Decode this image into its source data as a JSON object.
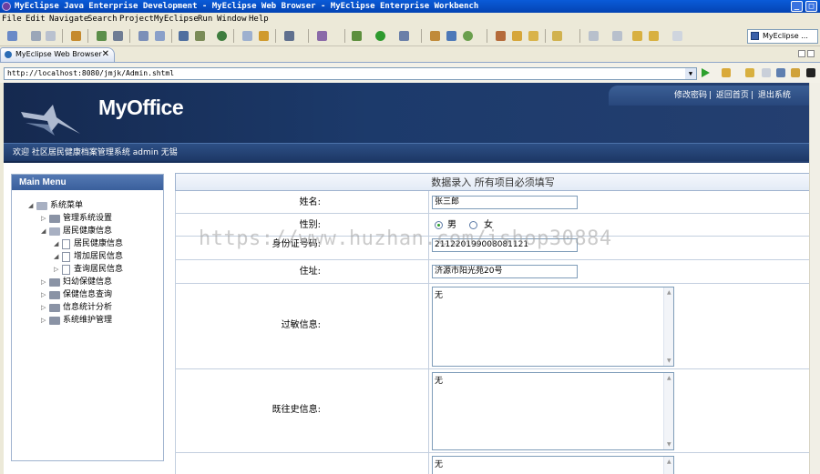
{
  "window": {
    "title": "MyEclipse Java Enterprise Development - MyEclipse Web Browser - MyEclipse Enterprise Workbench"
  },
  "menubar": [
    "File",
    "Edit",
    "Navigate",
    "Search",
    "Project",
    "MyEclipse",
    "Run",
    "Window",
    "Help"
  ],
  "toolbar": {
    "perspective_label": "MyEclipse ..."
  },
  "browser": {
    "tab_label": "MyEclipse Web Browser",
    "tab_close": "✕",
    "url": "http://localhost:8080/jmjk/Admin.shtml"
  },
  "site": {
    "logo": "MyOffice",
    "top_links": [
      "修改密码",
      "返回首页",
      "退出系统"
    ],
    "welcome": "欢迎 社区居民健康档案管理系统 admin 无锡"
  },
  "sidebar": {
    "title": "Main Menu",
    "root": "系统菜单",
    "items": [
      {
        "label": "管理系统设置"
      },
      {
        "label": "居民健康信息"
      },
      {
        "label": "居民健康信息"
      },
      {
        "label": "增加居民信息"
      },
      {
        "label": "查询居民信息"
      },
      {
        "label": "妇幼保健信息"
      },
      {
        "label": "保健信息查询"
      },
      {
        "label": "信息统计分析"
      },
      {
        "label": "系统维护管理"
      }
    ]
  },
  "form": {
    "title": "数据录入  所有项目必须填写",
    "name_label": "姓名:",
    "name_value": "张三郎",
    "gender_label": "性别:",
    "gender_male": "男",
    "gender_female": "女",
    "idcard_label": "身份证号码:",
    "idcard_value": "211220199008081121",
    "address_label": "住址:",
    "address_value": "济源市阳光苑20号",
    "allergy_label": "过敏信息:",
    "allergy_value": "无",
    "history_label": "既往史信息:",
    "history_value": "无",
    "extra_value": "无"
  },
  "watermark": "https://www.huzhan.com/ishop30884"
}
